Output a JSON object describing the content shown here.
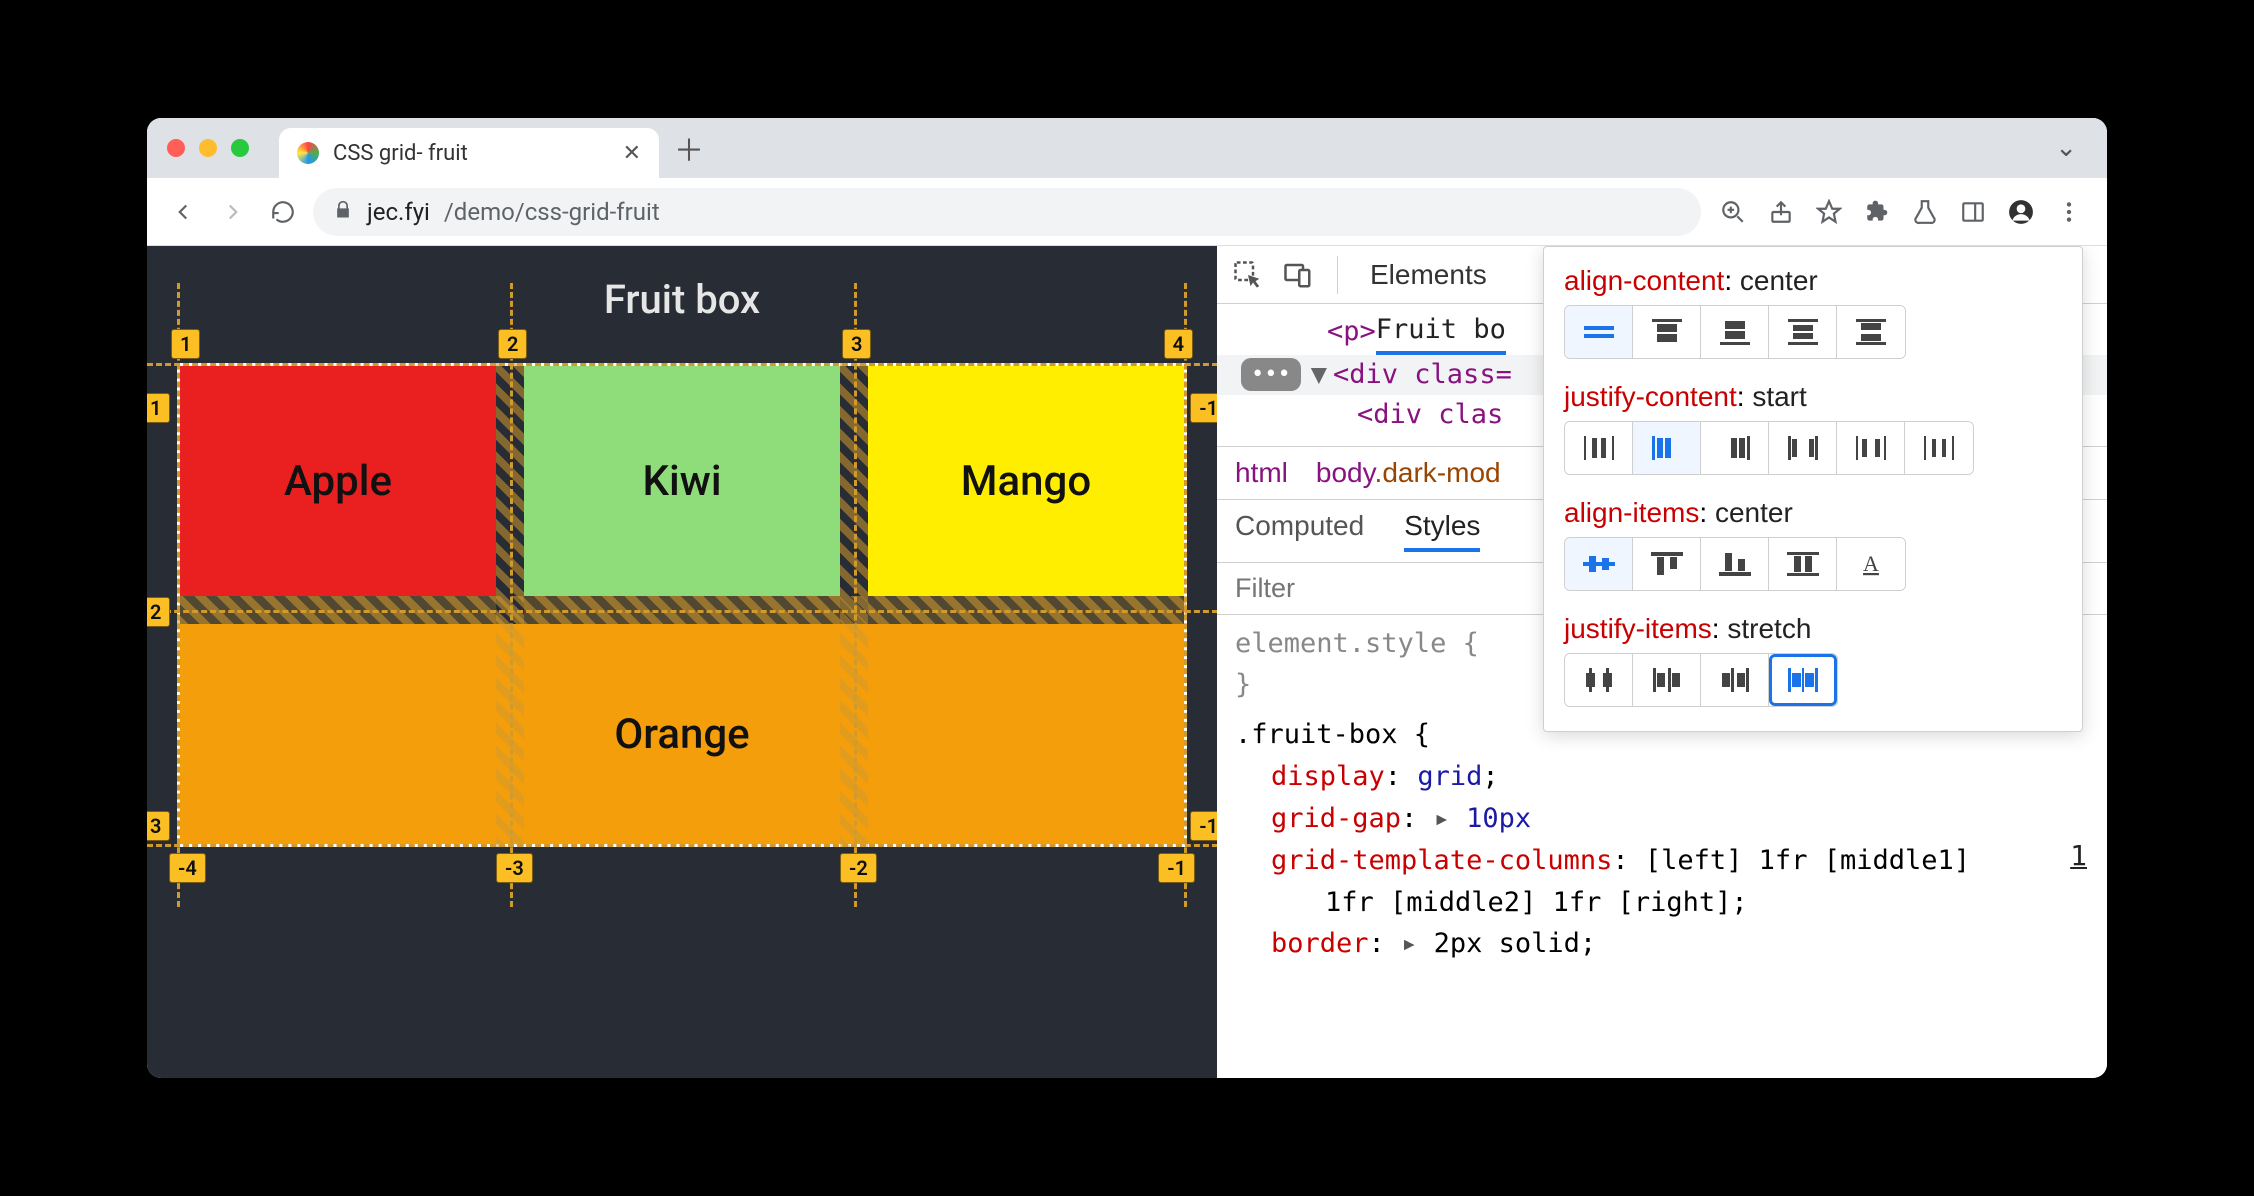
{
  "tab": {
    "title": "CSS grid- fruit"
  },
  "url": {
    "domain": "jec.fyi",
    "path": "/demo/css-grid-fruit"
  },
  "page": {
    "heading": "Fruit box",
    "grid_items": {
      "apple": "Apple",
      "kiwi": "Kiwi",
      "mango": "Mango",
      "orange": "Orange"
    },
    "col_lines": {
      "l1": "1",
      "l2": "2",
      "l3": "3",
      "l4": "4"
    },
    "row_lines": {
      "r1": "1",
      "r2": "2",
      "r3": "3"
    },
    "neg_lines": {
      "c1": "-4",
      "c2": "-3",
      "c3": "-2",
      "c4": "-1",
      "r1": "-1"
    }
  },
  "devtools": {
    "top_tabs": {
      "elements": "Elements"
    },
    "dom": {
      "p_open": "<p>",
      "p_text": "Fruit bo",
      "div1": "<div class=",
      "div2": "<div clas"
    },
    "breadcrumb": {
      "html": "html",
      "body": "body",
      "body_cls": ".dark-mod"
    },
    "subtabs": {
      "computed": "Computed",
      "styles": "Styles"
    },
    "filter_placeholder": "Filter",
    "styles": {
      "el_style_open": "element.style {",
      "el_style_close": "}",
      "rule_sel": ".fruit-box {",
      "display": {
        "prop": "display",
        "val": "grid"
      },
      "gap": {
        "prop": "grid-gap",
        "val": "10px"
      },
      "gtc": {
        "prop": "grid-template-columns",
        "val": "[left] 1fr [middle1]"
      },
      "gtc2": "1fr [middle2] 1fr [right];",
      "border": {
        "prop": "border",
        "val": "2px solid"
      },
      "origin": "1"
    }
  },
  "popover": {
    "align_content": {
      "prop": "align-content",
      "val": "center"
    },
    "justify_content": {
      "prop": "justify-content",
      "val": "start"
    },
    "align_items": {
      "prop": "align-items",
      "val": "center"
    },
    "justify_items": {
      "prop": "justify-items",
      "val": "stretch"
    }
  }
}
